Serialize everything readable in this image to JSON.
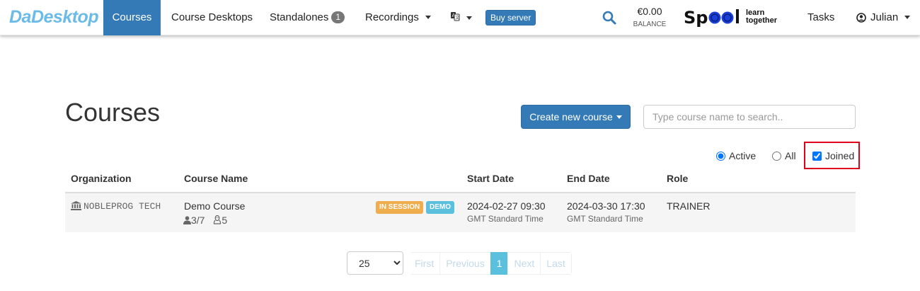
{
  "nav": {
    "brand": "DaDesktop",
    "courses": "Courses",
    "course_desktops": "Course Desktops",
    "standalones": "Standalones",
    "standalones_count": "1",
    "recordings": "Recordings",
    "language_icon": "translate-icon",
    "buy_server": "Buy server",
    "balance_amount": "€0.00",
    "balance_label": "BALANCE",
    "spool_word": "Spool",
    "spool_tag_line1": "learn",
    "spool_tag_line2": "together",
    "tasks": "Tasks",
    "user": "Julian",
    "accent_color": "#337ab7",
    "brand_color": "#6bbbe8"
  },
  "page": {
    "title": "Courses",
    "create_button": "Create new course",
    "search_placeholder": "Type course name to search..",
    "filters": {
      "active": "Active",
      "all": "All",
      "joined": "Joined",
      "selected": "Active",
      "joined_checked": true
    }
  },
  "table": {
    "headers": [
      "Organization",
      "Course Name",
      "Start Date",
      "End Date",
      "Role"
    ],
    "rows": [
      {
        "organization": "NOBLEPROG TECH",
        "course_name": "Demo Course",
        "users": "3/7",
        "linux": "5",
        "labels": [
          "IN SESSION",
          "DEMO"
        ],
        "start_date": "2024-02-27 09:30",
        "start_tz": "GMT Standard Time",
        "end_date": "2024-03-30 17:30",
        "end_tz": "GMT Standard Time",
        "role": "TRAINER"
      }
    ]
  },
  "pagination": {
    "page_size": "25",
    "first": "First",
    "previous": "Previous",
    "current": "1",
    "next": "Next",
    "last": "Last"
  }
}
